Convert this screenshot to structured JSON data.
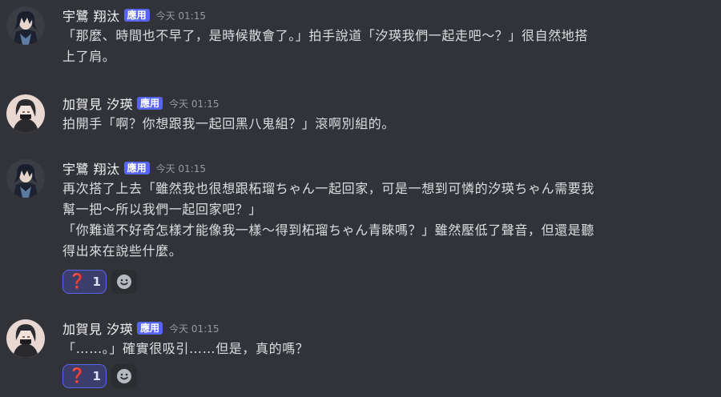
{
  "colors": {
    "background": "#313338",
    "badge": "#5865f2",
    "reaction_border": "#5865f2",
    "text": "#dbdee1",
    "muted": "#949ba4"
  },
  "messages": [
    {
      "username": "宇鷺 翔汰",
      "badge": "應用",
      "timestamp": "今天 01:15",
      "avatar_icon": "dark-haired-character-avatar",
      "lines": [
        "「那麼、時間也不早了，是時候散會了。」拍手說道「汐瑛我們一起走吧～？」很自然地搭",
        "上了肩。"
      ]
    },
    {
      "username": "加賀見 汐瑛",
      "badge": "應用",
      "timestamp": "今天 01:15",
      "avatar_icon": "masked-character-avatar",
      "lines": [
        "拍開手「啊？你想跟我一起回黑八鬼組？」滾啊別組的。"
      ]
    },
    {
      "username": "宇鷺 翔汰",
      "badge": "應用",
      "timestamp": "今天 01:15",
      "avatar_icon": "dark-haired-character-avatar",
      "lines": [
        "再次搭了上去「雖然我也很想跟柘瑠ちゃん一起回家，可是一想到可憐的汐瑛ちゃん需要我",
        "幫一把～所以我們一起回家吧？」",
        "「你難道不好奇怎樣才能像我一樣～得到柘瑠ちゃん青睞嗎？」雖然壓低了聲音，但還是聽",
        "得出來在說些什麼。"
      ],
      "reaction": {
        "emoji": "❓",
        "count": "1",
        "icon": "question-mark-icon"
      }
    },
    {
      "username": "加賀見 汐瑛",
      "badge": "應用",
      "timestamp": "今天 01:15",
      "avatar_icon": "masked-character-avatar",
      "lines": [
        "「……。」確實很吸引……但是，真的嗎？"
      ],
      "reaction": {
        "emoji": "❓",
        "count": "1",
        "icon": "question-mark-icon"
      }
    }
  ]
}
